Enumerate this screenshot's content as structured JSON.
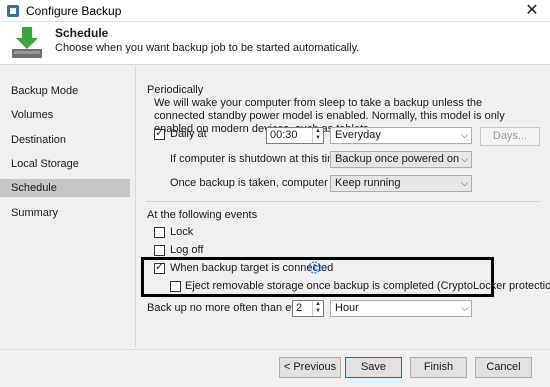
{
  "window": {
    "title": "Configure Backup",
    "close_glyph": "✕"
  },
  "header": {
    "title": "Schedule",
    "subtitle": "Choose when you want backup job to be started automatically."
  },
  "sidebar": {
    "items": [
      {
        "label": "Backup Mode"
      },
      {
        "label": "Volumes"
      },
      {
        "label": "Destination"
      },
      {
        "label": "Local Storage"
      },
      {
        "label": "Schedule",
        "selected": true
      },
      {
        "label": "Summary"
      }
    ]
  },
  "periodically": {
    "heading": "Periodically",
    "description": "We will wake your computer from sleep to take a backup unless the connected standby power model is enabled. Normally, this model is only enabled on modern devices, such as tablets.",
    "daily_label": "Daily at",
    "daily_checked": true,
    "time_value": "00:30",
    "frequency_value": "Everyday",
    "days_button": "Days...",
    "shutdown_label": "If computer is shutdown at this time",
    "shutdown_value": "Backup once powered on",
    "after_label": "Once backup is taken, computer should",
    "after_value": "Keep running"
  },
  "events": {
    "heading": "At the following events",
    "lock_label": "Lock",
    "lock_checked": false,
    "logoff_label": "Log off",
    "logoff_checked": false,
    "target_label": "When backup target is connected",
    "target_checked": true,
    "eject_label": "Eject removable storage once backup is completed (CryptoLocker protection)",
    "eject_checked": false,
    "frequency_label": "Back up no more often than every",
    "frequency_number": "2",
    "frequency_unit": "Hour"
  },
  "footer": {
    "previous": "< Previous",
    "save": "Save",
    "finish": "Finish",
    "cancel": "Cancel"
  },
  "colors": {
    "accent": "#0078d7",
    "selected_nav": "#c6c6c6",
    "info_blue": "#1e6fd9",
    "download_green": "#3aa53a"
  },
  "icons": {
    "app": "backup-app-icon",
    "header": "download-arrow-icon",
    "info": "info-icon",
    "check": "checkmark-icon"
  }
}
